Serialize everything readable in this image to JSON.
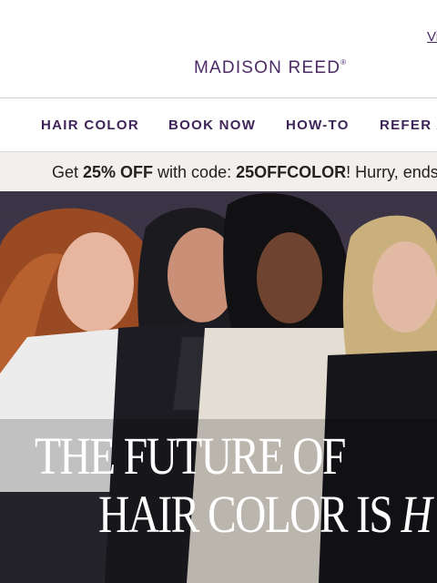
{
  "header": {
    "view_link": "Vi",
    "logo_text": "MADISON REED",
    "logo_mark": "®"
  },
  "nav": {
    "items": [
      {
        "label": "HAIR COLOR"
      },
      {
        "label": "BOOK NOW"
      },
      {
        "label": "HOW-TO"
      },
      {
        "label": "REFER A"
      }
    ]
  },
  "promo": {
    "pre": "Get ",
    "discount": "25% OFF",
    "mid": " with code: ",
    "code": "25OFFCOLOR",
    "post": "! Hurry, ends"
  },
  "hero": {
    "line1": "THE FUTURE OF",
    "line2_pre": "HAIR COLOR IS ",
    "line2_italic": "H"
  },
  "colors": {
    "brand_purple": "#4b2a66",
    "promo_bg": "#f3efec",
    "hero_text": "#ffffff"
  }
}
